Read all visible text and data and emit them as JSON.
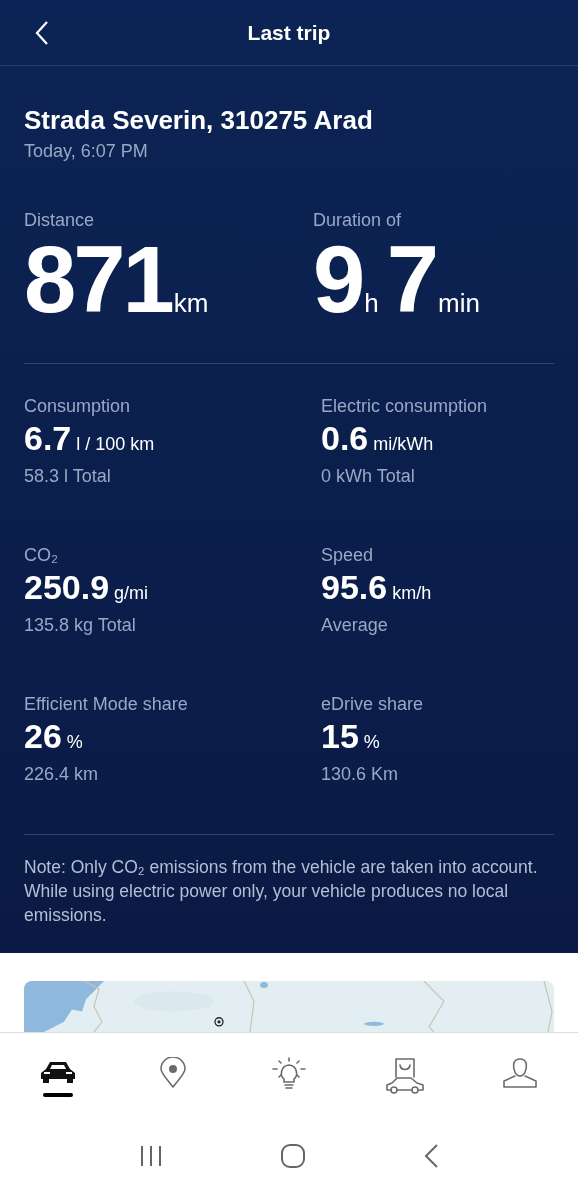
{
  "header": {
    "title": "Last trip"
  },
  "trip": {
    "address": "Strada Severin, 310275 Arad",
    "time": "Today, 6:07 PM"
  },
  "headline": [
    {
      "label": "Distance",
      "parts": [
        {
          "value": "871",
          "unit": "km"
        }
      ]
    },
    {
      "label": "Duration of",
      "parts": [
        {
          "value": "9",
          "unit": "h"
        },
        {
          "value": "7",
          "unit": "min"
        }
      ]
    }
  ],
  "stats": [
    {
      "label": "Consumption",
      "value": "6.7",
      "unit": "l / 100 km",
      "detail": "58.3 l Total"
    },
    {
      "label": "Electric consumption",
      "value": "0.6",
      "unit": "mi/kWh",
      "detail": "0 kWh Total"
    },
    {
      "label": "CO₂",
      "value": "250.9",
      "unit": "g/mi",
      "detail": "135.8 kg Total"
    },
    {
      "label": "Speed",
      "value": "95.6",
      "unit": "km/h",
      "detail": "Average"
    },
    {
      "label": "Efficient Mode share",
      "value": "26",
      "unit": "%",
      "detail": "226.4 km"
    },
    {
      "label": "eDrive share",
      "value": "15",
      "unit": "%",
      "detail": "130.6 Km"
    }
  ],
  "note": "Note: Only CO₂ emissions from the vehicle are taken into account. While using electric power only, your vehicle produces no local emissions.",
  "tab_bar": [
    {
      "kind": "car",
      "selected": true
    },
    {
      "kind": "pin",
      "selected": false
    },
    {
      "kind": "bulb",
      "selected": false
    },
    {
      "kind": "shop",
      "selected": false
    },
    {
      "kind": "person",
      "selected": false
    }
  ]
}
